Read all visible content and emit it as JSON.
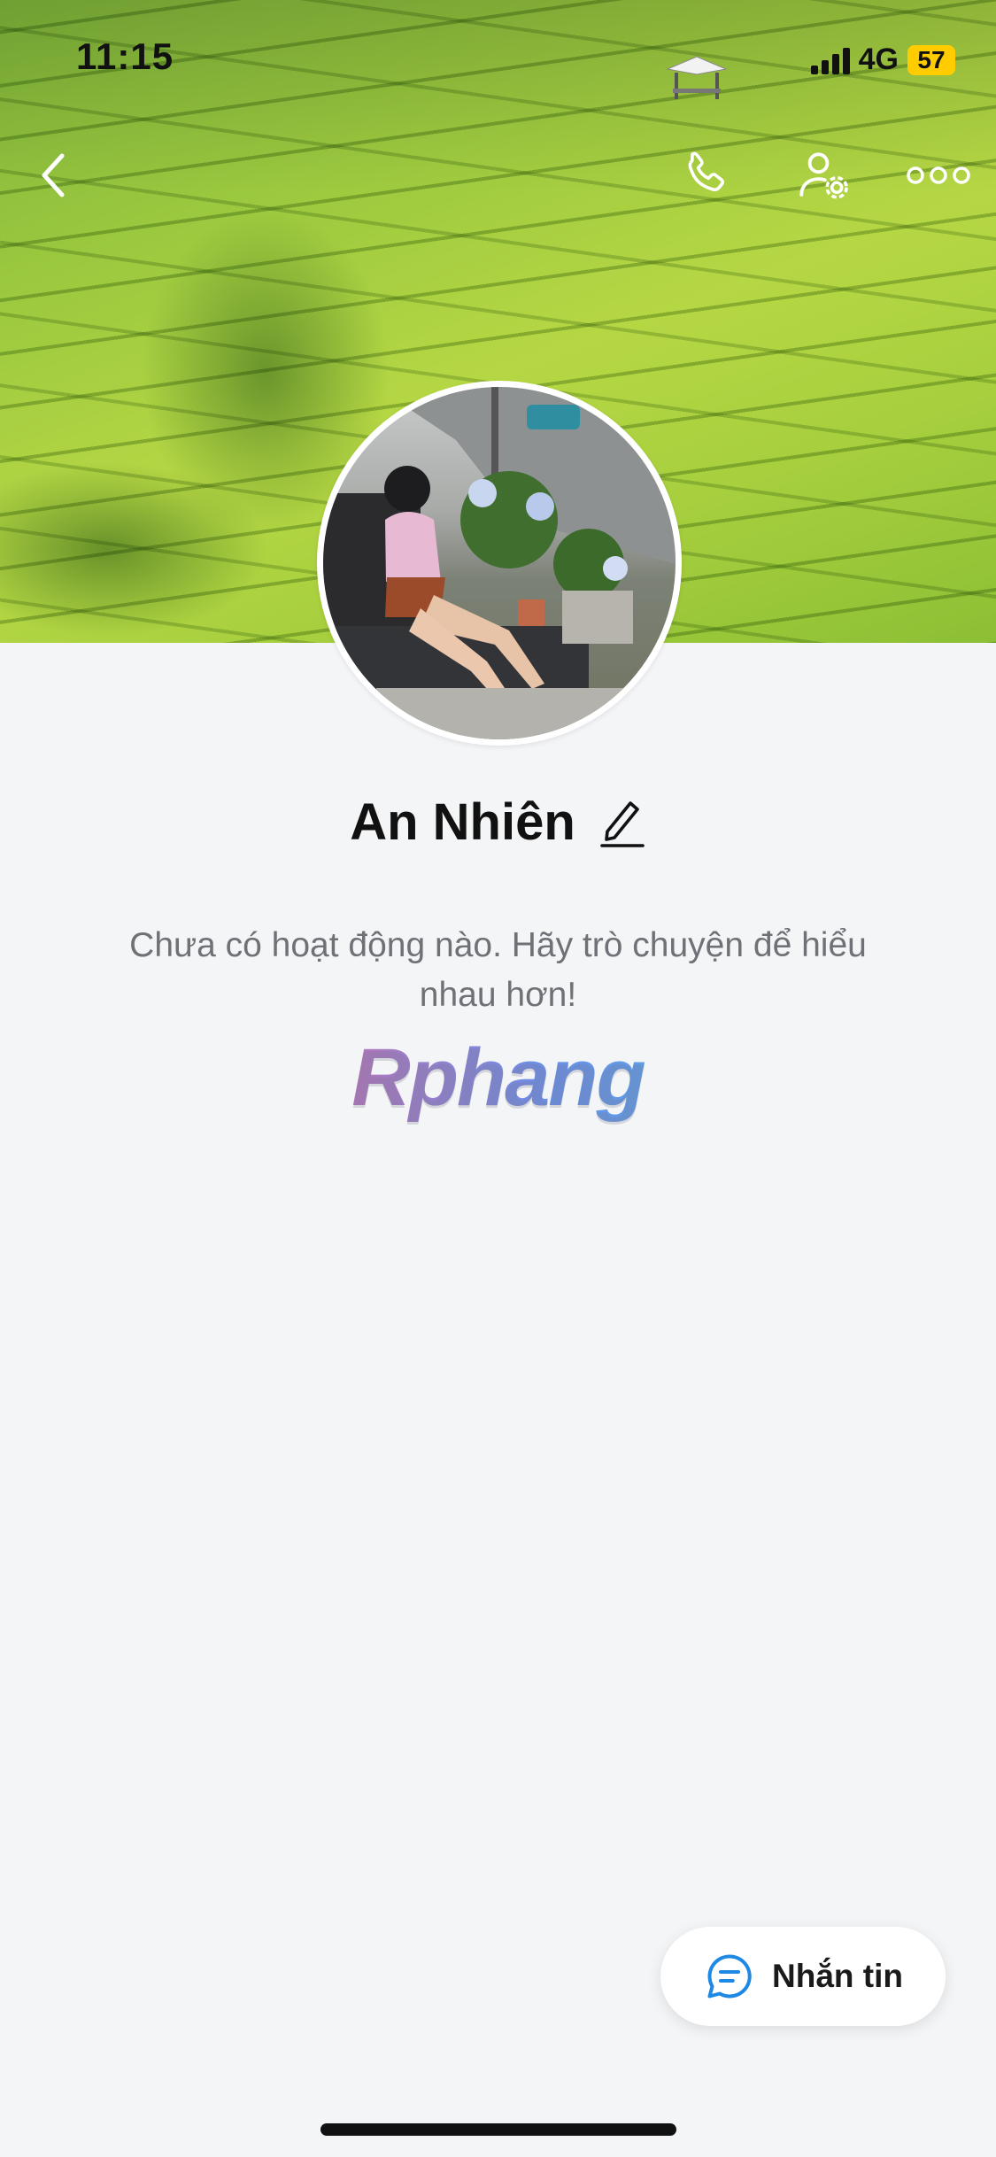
{
  "status_bar": {
    "time": "11:15",
    "network": "4G",
    "battery": "57"
  },
  "nav": {
    "icons": [
      "back-icon",
      "phone-icon",
      "user-settings-icon",
      "more-icon"
    ]
  },
  "profile": {
    "name": "An Nhiên",
    "empty_message": "Chưa có hoạt động nào. Hãy trò chuyện để hiểu nhau hơn!",
    "watermark": "Rphang"
  },
  "actions": {
    "message_label": "Nhắn tin"
  },
  "colors": {
    "accent": "#1e88e5",
    "background": "#f4f5f7",
    "battery": "#ffcc00"
  }
}
